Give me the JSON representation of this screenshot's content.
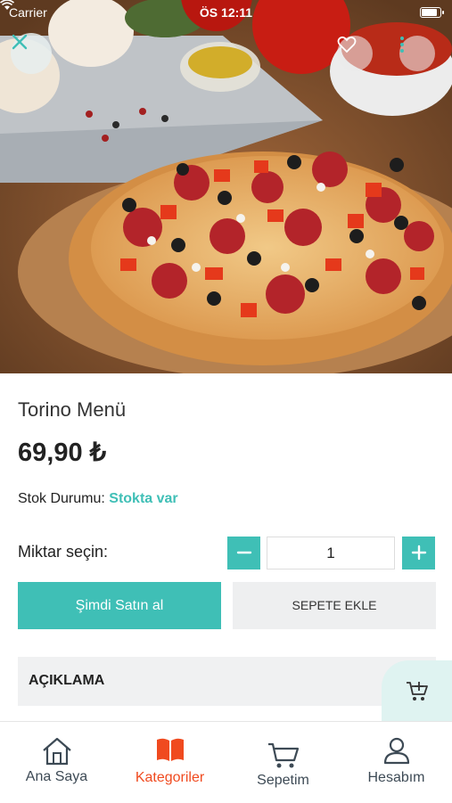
{
  "status_bar": {
    "carrier": "Carrier",
    "time": "ÖS 12:11",
    "battery_level": 0.95
  },
  "product": {
    "title": "Torino Menü",
    "price": "69,90 ₺",
    "stock_label": "Stok Durumu:",
    "stock_value": "Stokta var",
    "quantity_label": "Miktar seçin:",
    "quantity_value": "1",
    "buy_now_label": "Şimdi Satın al",
    "add_to_cart_label": "SEPETE EKLE",
    "description_label": "AÇIKLAMA"
  },
  "tabs": [
    {
      "label": "Ana Saya",
      "icon": "home-icon",
      "active": false
    },
    {
      "label": "Kategoriler",
      "icon": "book-icon",
      "active": true
    },
    {
      "label": "Sepetim",
      "icon": "cart-icon",
      "active": false
    },
    {
      "label": "Hesabım",
      "icon": "user-icon",
      "active": false
    }
  ],
  "colors": {
    "accent": "#3fbfb6",
    "active_tab": "#f04a1f",
    "tab_text": "#3d4a55",
    "button_gray": "#eeeff0"
  }
}
